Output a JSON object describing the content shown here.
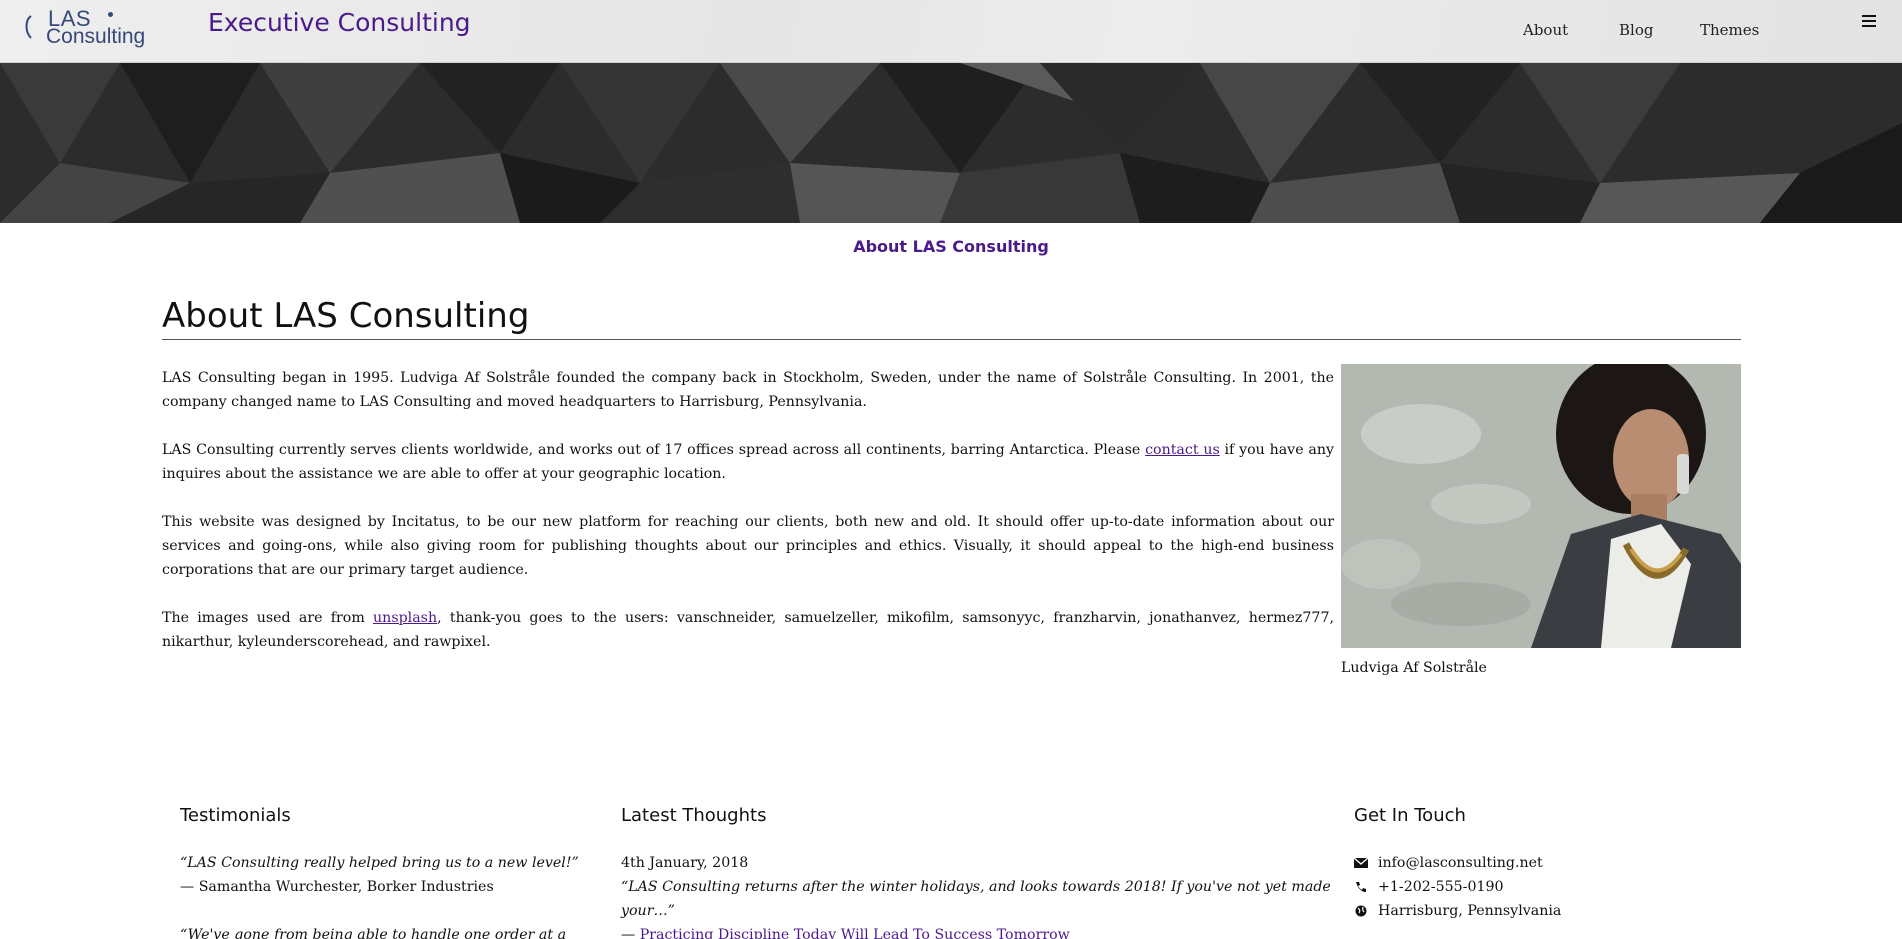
{
  "header": {
    "logo_line1": "LAS",
    "logo_line2": "Consulting",
    "site_title": "Executive Consulting",
    "nav": {
      "about": "About",
      "blog": "Blog",
      "themes": "Themes"
    },
    "menu_icon": "hamburger-icon"
  },
  "hero": {
    "subtitle": "About LAS Consulting"
  },
  "main": {
    "heading": "About LAS Consulting",
    "p1": "LAS Consulting began in 1995. Ludviga Af Solstråle founded the company back in Stockholm, Sweden, under the name of Solstråle Consulting. In 2001, the company changed name to LAS Consulting and moved headquarters to Harrisburg, Pennsylvania.",
    "p2_before": "LAS Consulting currently serves clients worldwide, and works out of 17 offices spread across all continents, barring Antarctica. Please ",
    "p2_link": "contact us",
    "p2_after": " if you have any inquires about the assistance we are able to offer at your geographic location.",
    "p3": "This website was designed by Incitatus, to be our new platform for reaching our clients, both new and old. It should offer up-to-date information about our services and going-ons, while also giving room for publishing thoughts about our principles and ethics. Visually, it should appeal to the high-end business corporations that are our primary target audience.",
    "p4_before": "The images used are from ",
    "p4_link": "unsplash",
    "p4_after": ", thank-you goes to the users: vanschneider, samuelzeller, mikofilm, samsonyyc, franzharvin, jonathanvez, hermez777, nikarthur, kyleunderscorehead, and rawpixel.",
    "image_caption": "Ludviga Af Solstråle"
  },
  "footer": {
    "testimonials": {
      "heading": "Testimonials",
      "quote1": "“LAS Consulting really helped bring us to a new level!”",
      "author1": "— Samantha Wurchester, Borker Industries",
      "quote2": "“We've gone from being able to handle one order at a time"
    },
    "thoughts": {
      "heading": "Latest Thoughts",
      "date": "4th January, 2018",
      "excerpt": "“LAS Consulting returns after the winter holidays, and looks towards 2018! If you've not yet made your…”",
      "dash": "— ",
      "link": "Practicing Discipline Today Will Lead To Success Tomorrow"
    },
    "contact": {
      "heading": "Get In Touch",
      "email": "info@lasconsulting.net",
      "phone": "+1-202-555-0190",
      "location": "Harrisburg, Pennsylvania",
      "icons": [
        "envelope-icon",
        "phone-icon",
        "globe-icon"
      ]
    }
  },
  "colors": {
    "accent": "#4b1a8a",
    "logo": "#35497a"
  }
}
